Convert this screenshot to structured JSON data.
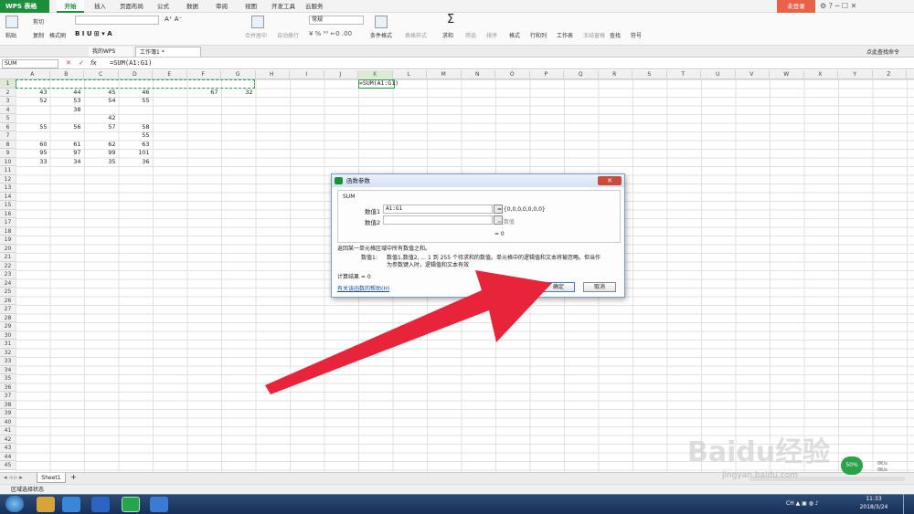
{
  "menubar": {
    "app_name": "WPS 表格",
    "tabs": [
      "开始",
      "插入",
      "页面布局",
      "公式",
      "数据",
      "审阅",
      "视图",
      "开发工具",
      "云服务"
    ],
    "login": "未登录"
  },
  "ribbon": {
    "cut": "剪切",
    "copy": "复制",
    "paste": "粘贴",
    "format_painter": "格式刷",
    "merge": "合并居中",
    "wrap": "自动换行",
    "number_format": "常规",
    "cond_format": "条件格式",
    "table_style": "表格样式",
    "sum": "求和",
    "filter": "筛选",
    "sort": "排序",
    "format": "格式",
    "rowcol": "行和列",
    "worksheet": "工作表",
    "freeze": "冻结窗格",
    "find": "查找",
    "symbol": "符号"
  },
  "doctabs": {
    "tab1": "我的WPS",
    "tab2": "工作簿1 *",
    "right_hint": "点此查找命令"
  },
  "formulabar": {
    "namebox": "SUM",
    "fx": "fx",
    "formula": "=SUM(A1:G1)"
  },
  "columns": [
    "A",
    "B",
    "C",
    "D",
    "E",
    "F",
    "G",
    "H",
    "I",
    "J",
    "K",
    "L",
    "M",
    "N",
    "O",
    "P",
    "Q",
    "R",
    "S",
    "T",
    "U",
    "V",
    "W",
    "X",
    "Y",
    "Z"
  ],
  "rows": [
    "1",
    "2",
    "3",
    "4",
    "5",
    "6",
    "7",
    "8",
    "9",
    "10",
    "11",
    "12",
    "13",
    "14",
    "15",
    "16",
    "17",
    "18",
    "19",
    "20",
    "21",
    "22",
    "23",
    "24",
    "25",
    "26",
    "27",
    "28",
    "29",
    "30",
    "31",
    "32",
    "33",
    "34",
    "35",
    "36",
    "37",
    "38",
    "39",
    "40",
    "41",
    "42",
    "43",
    "44",
    "45"
  ],
  "cells": {
    "r2": [
      "43",
      "44",
      "45",
      "46",
      "",
      "67",
      "32"
    ],
    "r3": [
      "52",
      "53",
      "54",
      "55",
      "",
      "",
      ""
    ],
    "r4": [
      "",
      "38",
      "",
      "",
      "",
      "",
      ""
    ],
    "r5": [
      "",
      "",
      "42",
      "",
      "",
      "",
      ""
    ],
    "r6": [
      "55",
      "56",
      "57",
      "58",
      "",
      "",
      ""
    ],
    "r7": [
      "",
      "",
      "",
      "55",
      "",
      "",
      ""
    ],
    "r8": [
      "60",
      "61",
      "62",
      "63",
      "",
      "",
      ""
    ],
    "r9": [
      "95",
      "97",
      "99",
      "101",
      "",
      "",
      ""
    ],
    "r10": [
      "33",
      "34",
      "35",
      "36",
      "",
      "",
      ""
    ],
    "k1": "=SUM(A1:G1)"
  },
  "sheet": {
    "tab": "Sheet1",
    "add": "+"
  },
  "status": "区域选择状态",
  "dialog": {
    "title": "函数参数",
    "func": "SUM",
    "arg1_label": "数值1",
    "arg1_value": "A1:G1",
    "arg1_result": "= {0,0,0,0,0,0,0}",
    "arg2_label": "数值2",
    "arg2_result": "= 数值",
    "eq_result": "= 0",
    "desc": "返回某一单元格区域中所有数值之和。",
    "param_name": "数值1:",
    "param_desc1": "数值1,数值2, ... 1 到 255 个待求和的数值。单元格中的逻辑值和文本将被忽略。但当作",
    "param_desc2": "为参数键入时，逻辑值和文本有效",
    "calc_result": "计算结果 = 0",
    "help_link": "有关该函数的帮助(H)",
    "ok": "确定",
    "cancel": "取消"
  },
  "watermark": {
    "text": "Baidu经验",
    "url": "jingyan.baidu.com"
  },
  "tray": {
    "time": "11:33",
    "date": "2018/3/24",
    "speed1": "0K/s",
    "speed2": "0K/s",
    "percent": "50%"
  },
  "colors": {
    "accent": "#1d8f3b",
    "arrow": "#e8243b",
    "login": "#e8624a"
  }
}
